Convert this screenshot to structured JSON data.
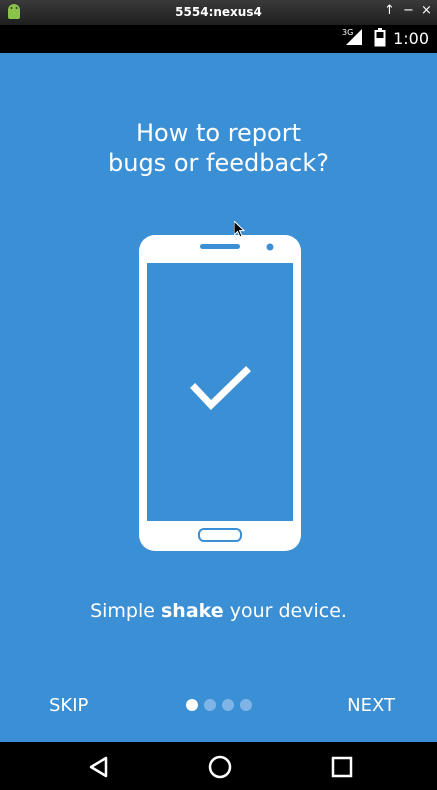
{
  "window": {
    "title": "5554:nexus4",
    "controls": [
      "↑",
      "−",
      "×"
    ]
  },
  "statusbar": {
    "network": "3G",
    "time": "1:00",
    "icons": [
      "signal-icon",
      "battery-icon"
    ]
  },
  "onboarding": {
    "heading_line1": "How to report",
    "heading_line2": "bugs or feedback?",
    "subtitle_pre": "Simple ",
    "subtitle_bold": "shake",
    "subtitle_post": " your device.",
    "skip_label": "SKIP",
    "next_label": "NEXT",
    "page_indicator": {
      "current": 1,
      "total": 4
    },
    "illustration": "phone-checkmark-icon"
  },
  "navbar": {
    "buttons": [
      "back-icon",
      "home-icon",
      "recents-icon"
    ]
  },
  "colors": {
    "background": "#3b8fd5",
    "text": "#ffffff",
    "dot_inactive": "#7fb4e6"
  }
}
